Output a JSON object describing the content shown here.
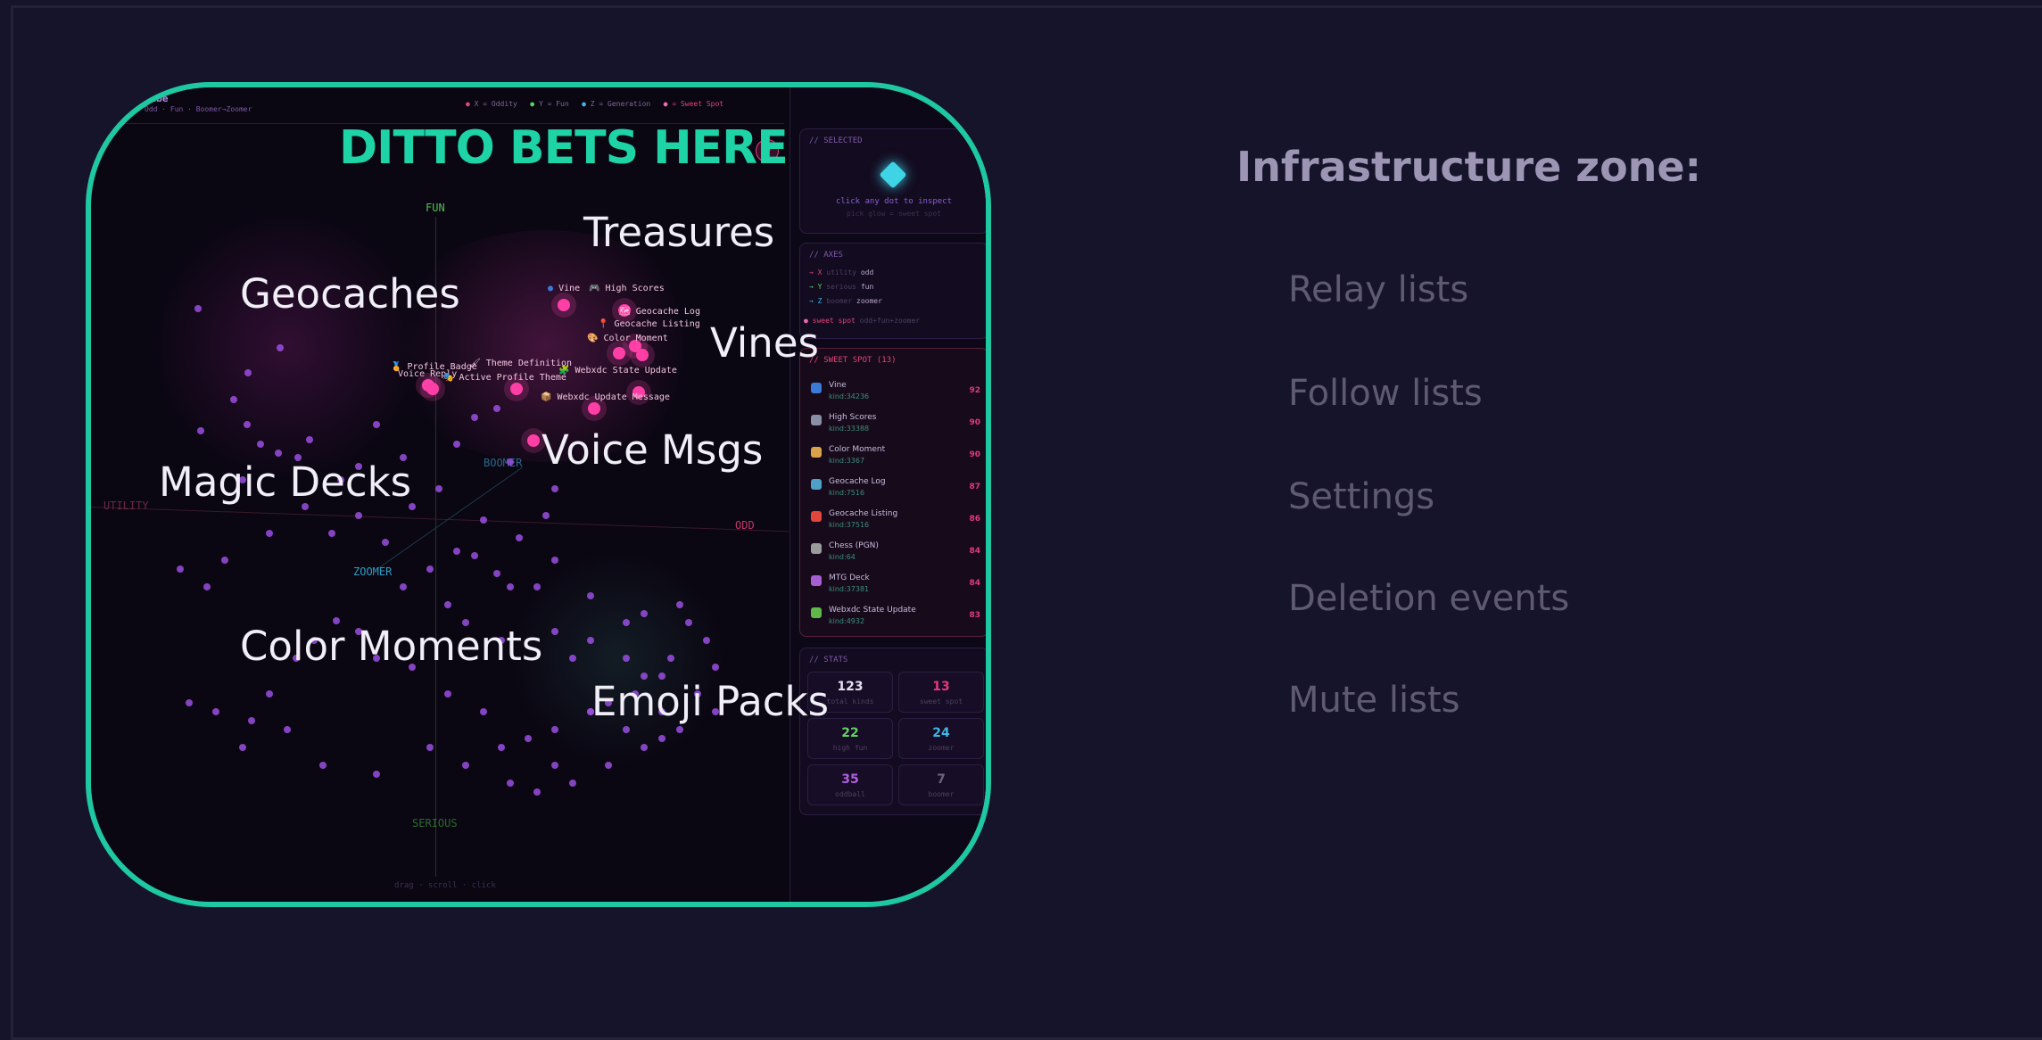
{
  "overlay": {
    "title": "DITTO BETS HERE",
    "labels": {
      "treasures": "Treasures",
      "geocaches": "Geocaches",
      "vines": "Vines",
      "voice_msgs": "Voice Msgs",
      "magic_decks": "Magic Decks",
      "color_moments": "Color Moments",
      "emoji_packs": "Emoji Packs"
    }
  },
  "app": {
    "title": "Cube",
    "subtitle": "Odd · Fun · Boomer→Zoomer",
    "legend": [
      "X = Oddity",
      "Y = Fun",
      "Z = Generation",
      "= Sweet Spot"
    ],
    "legend_colors": [
      "#e0457a",
      "#5fd35f",
      "#3fb6e6",
      "#f06bb0"
    ],
    "axes": {
      "fun": "FUN",
      "serious": "SERIOUS",
      "odd": "ODD",
      "utility": "UTILITY",
      "boomer": "BOOMER",
      "zoomer": "ZOOMER"
    },
    "point_labels": {
      "vine": "Vine",
      "high_scores": "High Scores",
      "geocache_log": "Geocache Log",
      "geocache_listing": "Geocache Listing",
      "color_moment": "Color Moment",
      "theme_definition": "Theme Definition",
      "profile_badge": "Profile Badge",
      "voice_reply": "Voice Reply",
      "active_profile_theme": "Active Profile Theme",
      "webxdc_state_update": "Webxdc State Update",
      "webxdc_update_message": "Webxdc Update Message"
    },
    "hint": "drag · scroll · click"
  },
  "sidebar": {
    "selected": {
      "title": "// SELECTED",
      "prompt": "click any dot to inspect",
      "sub": "pick glow = sweet spot"
    },
    "axes_card": {
      "title": "// AXES",
      "rows": [
        {
          "axis": "→ X",
          "from": "utility",
          "to": "odd"
        },
        {
          "axis": "→ Y",
          "from": "serious",
          "to": "fun"
        },
        {
          "axis": "→ Z",
          "from": "boomer",
          "to": "zoomer"
        }
      ],
      "sweet": "sweet spot",
      "sweet_desc": "odd+fun+zoomer"
    },
    "sweet_spot": {
      "title": "// SWEET SPOT (13)",
      "items": [
        {
          "name": "Vine",
          "kind": "kind:34236",
          "score": "92",
          "color": "#3b7bd8"
        },
        {
          "name": "High Scores",
          "kind": "kind:33388",
          "score": "90",
          "color": "#8a8fa3"
        },
        {
          "name": "Color Moment",
          "kind": "kind:3367",
          "score": "90",
          "color": "#d9a14a"
        },
        {
          "name": "Geocache Log",
          "kind": "kind:7516",
          "score": "87",
          "color": "#4ea0c8"
        },
        {
          "name": "Geocache Listing",
          "kind": "kind:37516",
          "score": "86",
          "color": "#e0463a"
        },
        {
          "name": "Chess (PGN)",
          "kind": "kind:64",
          "score": "84",
          "color": "#9a9a9a"
        },
        {
          "name": "MTG Deck",
          "kind": "kind:37381",
          "score": "84",
          "color": "#a55fd3"
        },
        {
          "name": "Webxdc State Update",
          "kind": "kind:4932",
          "score": "83",
          "color": "#5fb84a"
        }
      ]
    },
    "stats": {
      "title": "// STATS",
      "items": [
        {
          "value": "123",
          "label": "total kinds",
          "color": "#e6e2f0"
        },
        {
          "value": "13",
          "label": "sweet spot",
          "color": "#e23a7a"
        },
        {
          "value": "22",
          "label": "high fun",
          "color": "#5fd35f"
        },
        {
          "value": "24",
          "label": "zoomer",
          "color": "#3fb6e6"
        },
        {
          "value": "35",
          "label": "oddball",
          "color": "#b25fe0"
        },
        {
          "value": "7",
          "label": "boomer",
          "color": "#6d6580"
        }
      ]
    }
  },
  "infrastructure": {
    "title": "Infrastructure zone:",
    "items": [
      "Relay lists",
      "Follow lists",
      "Settings",
      "Deletion events",
      "Mute lists"
    ]
  }
}
